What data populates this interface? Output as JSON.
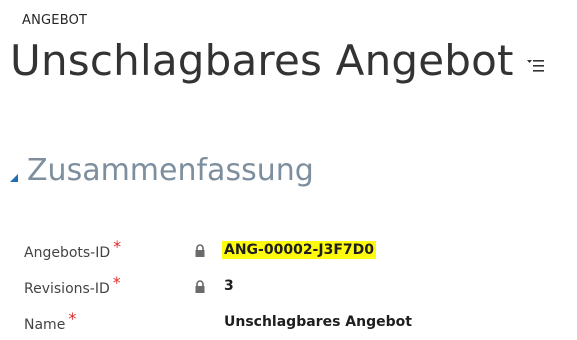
{
  "header": {
    "entity_type": "ANGEBOT",
    "record_title": "Unschlagbares Angebot",
    "menu_icon": "list-menu-icon"
  },
  "section": {
    "title": "Zusammenfassung",
    "collapse_icon": "collapse-triangle-icon",
    "title_color": "#7d8f9e"
  },
  "fields": [
    {
      "label": "Angebots-ID",
      "required": "*",
      "locked": true,
      "value": "ANG-00002-J3F7D0",
      "highlighted": true
    },
    {
      "label": "Revisions-ID",
      "required": "*",
      "locked": true,
      "value": "3",
      "highlighted": false
    },
    {
      "label": "Name",
      "required": "*",
      "locked": false,
      "value": "Unschlagbares Angebot",
      "highlighted": false
    }
  ],
  "colors": {
    "required": "#e02b2b",
    "highlight": "#fffb0f",
    "lock": "#6b6b6b"
  }
}
